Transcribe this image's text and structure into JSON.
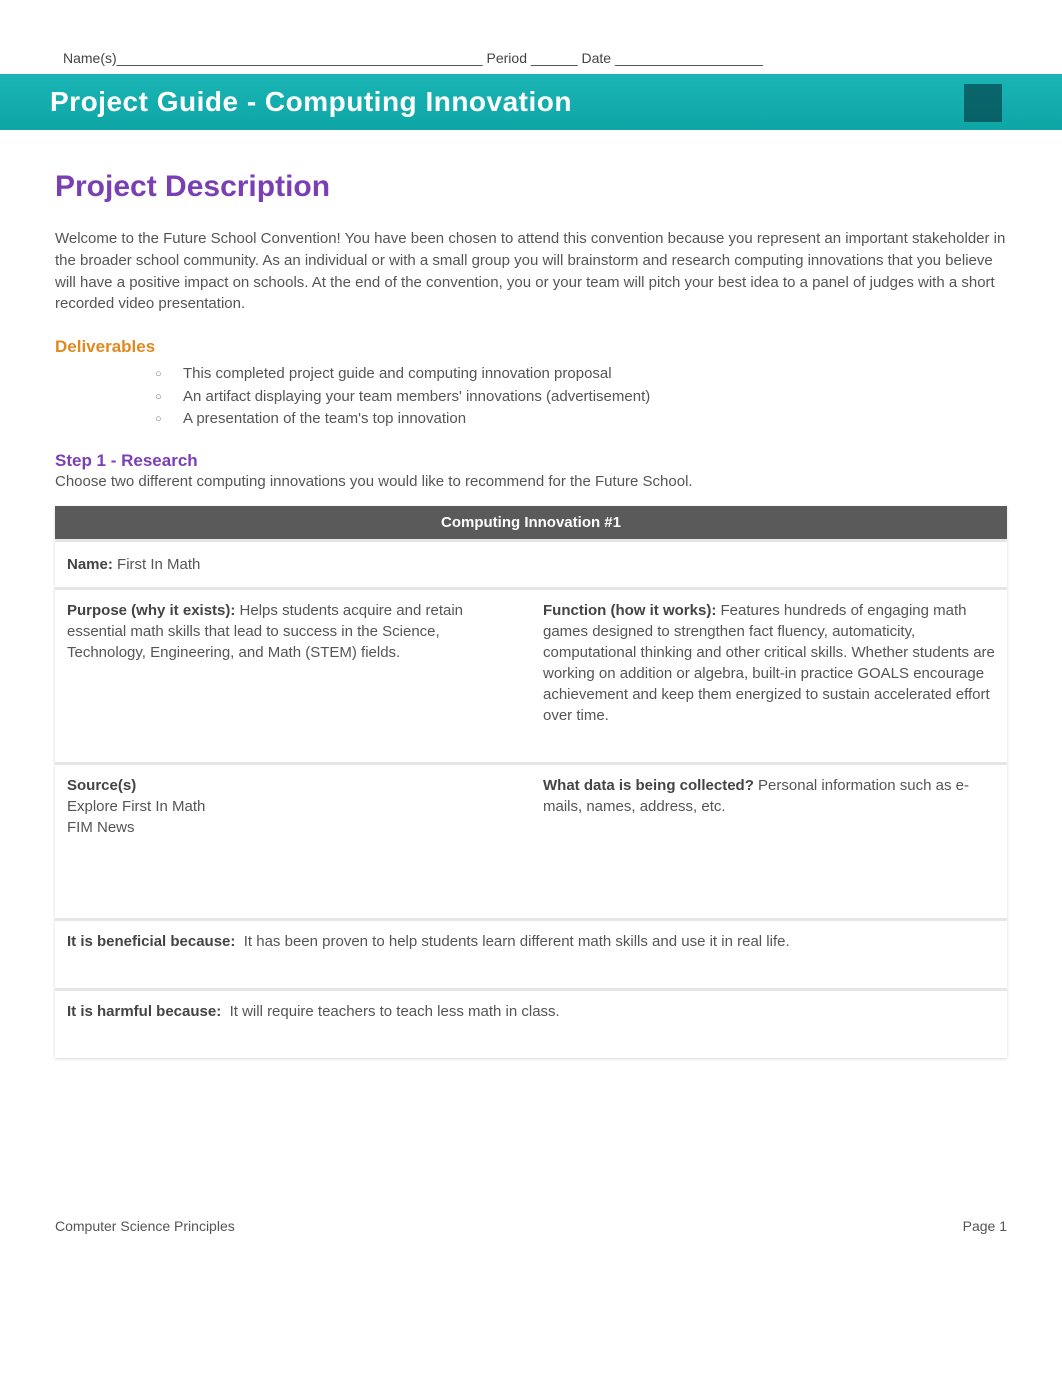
{
  "header": {
    "names_label": "Name(s)",
    "names_line": "_______________________________________________",
    "period_label": "Period",
    "period_line": "______",
    "date_label": "Date",
    "date_line": "___________________"
  },
  "banner": {
    "title": "Project Guide - Computing Innovation"
  },
  "section_title": "Project Description",
  "intro_text": "Welcome to the Future School Convention! You have been chosen to attend this convention because you represent an important stakeholder in the broader school community. As an individual or with a small group you will brainstorm and research computing innovations that you believe will have a positive impact on schools. At the end of the convention, you or your team will pitch your best idea to a panel of judges with a short recorded video presentation.",
  "deliverables": {
    "heading": "Deliverables",
    "items": [
      "This completed project guide and computing innovation proposal",
      "An artifact displaying your team members' innovations (advertisement)",
      "A presentation of the team's top innovation"
    ]
  },
  "step1": {
    "heading": "Step 1 - Research",
    "sub": "Choose two different computing innovations you would like to recommend for the Future School."
  },
  "table": {
    "header": "Computing Innovation #1",
    "name_label": "Name:",
    "name_value": "First In Math",
    "purpose_label": "Purpose (why it exists):",
    "purpose_text": "Helps students acquire and retain essential math skills that lead to success in the Science, Technology, Engineering, and Math (STEM) fields.",
    "function_label": "Function (how it works):",
    "function_text": "Features hundreds of engaging math games designed to strengthen fact fluency, automaticity, computational thinking and other critical skills. Whether students are working on addition or algebra, built-in practice GOALS encourage achievement and keep them energized to sustain accelerated effort over time.",
    "sources_label": "Source(s)",
    "sources_lines": [
      "Explore First In Math",
      "FIM News"
    ],
    "data_label": "What data is being collected?",
    "data_text": "Personal information such as e-mails, names, address, etc.",
    "beneficial_label": "It is beneficial because:",
    "beneficial_text": "It has been proven to help students learn different math skills and use it in real life.",
    "harmful_label": "It is harmful because:",
    "harmful_text": "It will require teachers to teach less math in class."
  },
  "footer": {
    "left": "Computer Science Principles",
    "right": "Page 1"
  }
}
